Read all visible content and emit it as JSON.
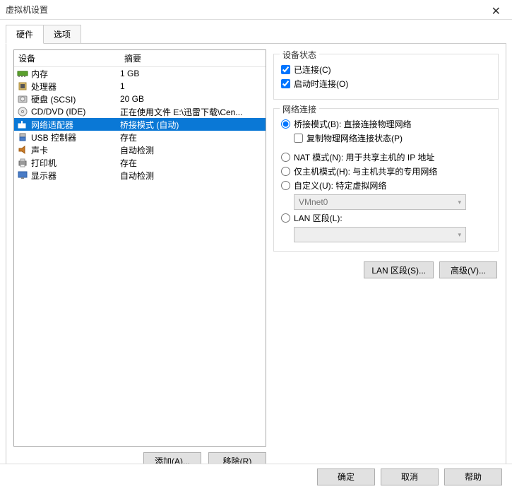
{
  "window": {
    "title": "虚拟机设置"
  },
  "tabs": {
    "hardware": "硬件",
    "options": "选项"
  },
  "list": {
    "col_device": "设备",
    "col_summary": "摘要",
    "rows": [
      {
        "device": "内存",
        "summary": "1 GB"
      },
      {
        "device": "处理器",
        "summary": "1"
      },
      {
        "device": "硬盘 (SCSI)",
        "summary": "20 GB"
      },
      {
        "device": "CD/DVD (IDE)",
        "summary": "正在使用文件 E:\\迅雷下载\\Cen..."
      },
      {
        "device": "网络适配器",
        "summary": "桥接模式 (自动)"
      },
      {
        "device": "USB 控制器",
        "summary": "存在"
      },
      {
        "device": "声卡",
        "summary": "自动检测"
      },
      {
        "device": "打印机",
        "summary": "存在"
      },
      {
        "device": "显示器",
        "summary": "自动检测"
      }
    ]
  },
  "left_buttons": {
    "add": "添加(A)...",
    "remove": "移除(R)"
  },
  "device_state": {
    "legend": "设备状态",
    "connected": "已连接(C)",
    "connect_on_poweron": "启动时连接(O)"
  },
  "network": {
    "legend": "网络连接",
    "bridged": "桥接模式(B): 直接连接物理网络",
    "replicate": "复制物理网络连接状态(P)",
    "nat": "NAT 模式(N): 用于共享主机的 IP 地址",
    "hostonly": "仅主机模式(H): 与主机共享的专用网络",
    "custom": "自定义(U): 特定虚拟网络",
    "custom_value": "VMnet0",
    "lanseg": "LAN 区段(L):",
    "lanseg_value": ""
  },
  "right_buttons": {
    "lan_segments": "LAN 区段(S)...",
    "advanced": "高级(V)..."
  },
  "footer": {
    "ok": "确定",
    "cancel": "取消",
    "help": "帮助"
  }
}
